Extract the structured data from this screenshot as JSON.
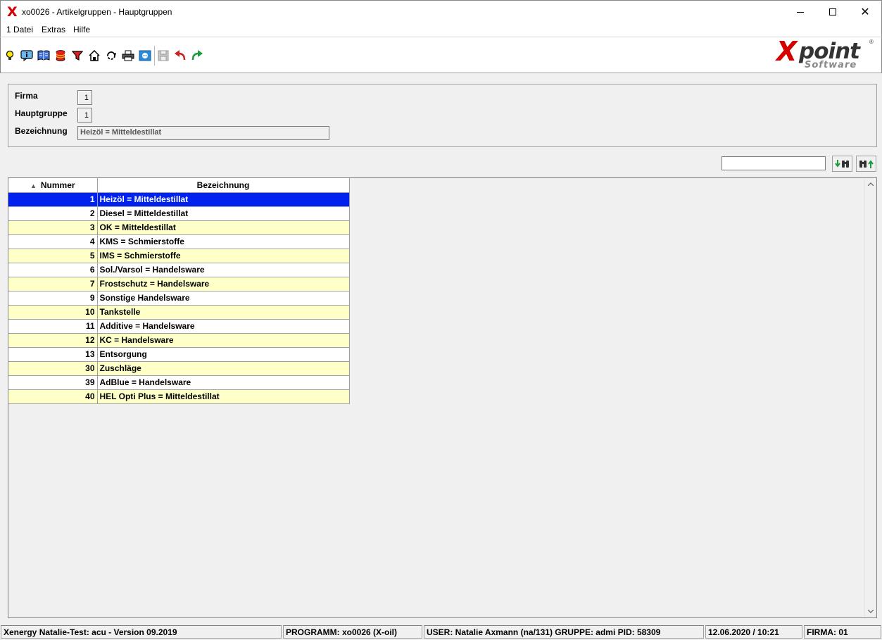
{
  "window": {
    "title": "xo0026 - Artikelgruppen - Hauptgruppen",
    "app_icon": "X",
    "controls": [
      "minimize-icon",
      "maximize-icon",
      "close-icon"
    ]
  },
  "menu": {
    "items": [
      "1 Datei",
      "Extras",
      "Hilfe"
    ]
  },
  "toolbar": {
    "icons": [
      "lightbulb-icon",
      "info-icon",
      "book-icon",
      "database-icon",
      "filter-icon",
      "home-icon",
      "refresh-icon",
      "print-icon",
      "hotkey-icon",
      "save-icon",
      "undo-icon",
      "redo-icon"
    ]
  },
  "logo": {
    "x": "X",
    "point": "point",
    "software": "Software",
    "reg": "®"
  },
  "header": {
    "firma_label": "Firma",
    "firma_value": "1",
    "hauptgruppe_label": "Hauptgruppe",
    "hauptgruppe_value": "1",
    "bezeichnung_label": "Bezeichnung",
    "bezeichnung_value": "Heizöl = Mitteldestillat"
  },
  "search": {
    "value": "",
    "find_down_icon": "find-down-icon",
    "find_up_icon": "find-up-icon"
  },
  "grid": {
    "columns": [
      "Nummer",
      "Bezeichnung"
    ],
    "sort_column": "Nummer",
    "selected_index": 0,
    "rows": [
      {
        "nummer": "1",
        "bezeichnung": "Heizöl = Mitteldestillat"
      },
      {
        "nummer": "2",
        "bezeichnung": "Diesel = Mitteldestillat"
      },
      {
        "nummer": "3",
        "bezeichnung": "OK = Mitteldestillat"
      },
      {
        "nummer": "4",
        "bezeichnung": "KMS = Schmierstoffe"
      },
      {
        "nummer": "5",
        "bezeichnung": "IMS = Schmierstoffe"
      },
      {
        "nummer": "6",
        "bezeichnung": "Sol./Varsol = Handelsware"
      },
      {
        "nummer": "7",
        "bezeichnung": "Frostschutz = Handelsware"
      },
      {
        "nummer": "9",
        "bezeichnung": "Sonstige Handelsware"
      },
      {
        "nummer": "10",
        "bezeichnung": "Tankstelle"
      },
      {
        "nummer": "11",
        "bezeichnung": "Additive = Handelsware"
      },
      {
        "nummer": "12",
        "bezeichnung": "KC = Handelsware"
      },
      {
        "nummer": "13",
        "bezeichnung": "Entsorgung"
      },
      {
        "nummer": "30",
        "bezeichnung": "Zuschläge"
      },
      {
        "nummer": "39",
        "bezeichnung": "AdBlue = Handelsware"
      },
      {
        "nummer": "40",
        "bezeichnung": "HEL Opti Plus = Mitteldestillat"
      }
    ]
  },
  "status": {
    "version": "Xenergy Natalie-Test: acu - Version 09.2019",
    "programm": "PROGRAMM: xo0026 (X-oil)",
    "user": "USER: Natalie Axmann (na/131)  GRUPPE: admi  PID: 58309",
    "datetime": "12.06.2020 / 10:21",
    "firma": "FIRMA: 01"
  },
  "colors": {
    "selected_row": "#0022ee",
    "odd_row": "#ffffc8",
    "brand_red": "#d40000"
  }
}
